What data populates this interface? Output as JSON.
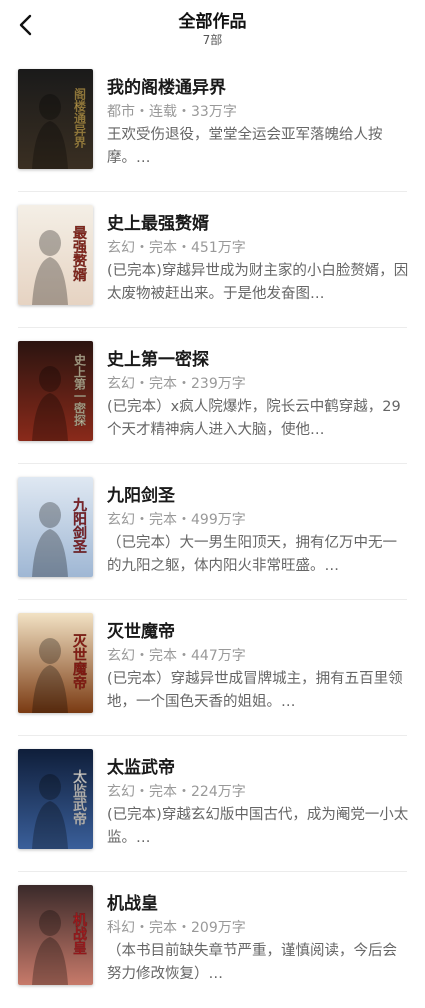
{
  "header": {
    "title": "全部作品",
    "count": "7部"
  },
  "books": [
    {
      "title": "我的阁楼通异界",
      "meta": "都市・连载・33万字",
      "desc": "王欢受伤退役，堂堂全运会亚军落魄给人按摩。…",
      "cover": {
        "text": "阁楼通异界",
        "bg1": "#1a1a1a",
        "bg2": "#3a2f22",
        "accent": "#d9b45a"
      }
    },
    {
      "title": "史上最强赘婿",
      "meta": "玄幻・完本・451万字",
      "desc": "(已完本)穿越异世成为财主家的小白脸赘婿，因太废物被赶出来。于是他发奋图…",
      "cover": {
        "text": "最强赘婿",
        "bg1": "#f4efe6",
        "bg2": "#e6d3c2",
        "accent": "#c0392b"
      }
    },
    {
      "title": "史上第一密探",
      "meta": "玄幻・完本・239万字",
      "desc": "(已完本）x疯人院爆炸，院长云中鹤穿越，29个天才精神病人进入大脑，使他…",
      "cover": {
        "text": "史上第一密探",
        "bg1": "#2b1410",
        "bg2": "#8a2a1a",
        "accent": "#f2e3c0"
      }
    },
    {
      "title": "九阳剑圣",
      "meta": "玄幻・完本・499万字",
      "desc": "（已完本）大一男生阳顶天，拥有亿万中无一的九阳之躯，体内阳火非常旺盛。…",
      "cover": {
        "text": "九阳剑圣",
        "bg1": "#dfe8f2",
        "bg2": "#9fb7d4",
        "accent": "#b0303a"
      }
    },
    {
      "title": "灭世魔帝",
      "meta": "玄幻・完本・447万字",
      "desc": "(已完本）穿越异世成冒牌城主，拥有五百里领地，一个国色天香的姐姐。…",
      "cover": {
        "text": "灭世魔帝",
        "bg1": "#f2e2c4",
        "bg2": "#7a3a12",
        "accent": "#c0281c"
      }
    },
    {
      "title": "太监武帝",
      "meta": "玄幻・完本・224万字",
      "desc": "(已完本)穿越玄幻版中国古代，成为阉党一小太监。…",
      "cover": {
        "text": "太监武帝",
        "bg1": "#0f1e3a",
        "bg2": "#3a5f9a",
        "accent": "#ffffff"
      }
    },
    {
      "title": "机战皇",
      "meta": "科幻・完本・209万字",
      "desc": "（本书目前缺失章节严重，谨慎阅读，今后会努力修改恢复）…",
      "cover": {
        "text": "机战皇",
        "bg1": "#3a2a2a",
        "bg2": "#c77a6a",
        "accent": "#e0262a"
      }
    }
  ]
}
